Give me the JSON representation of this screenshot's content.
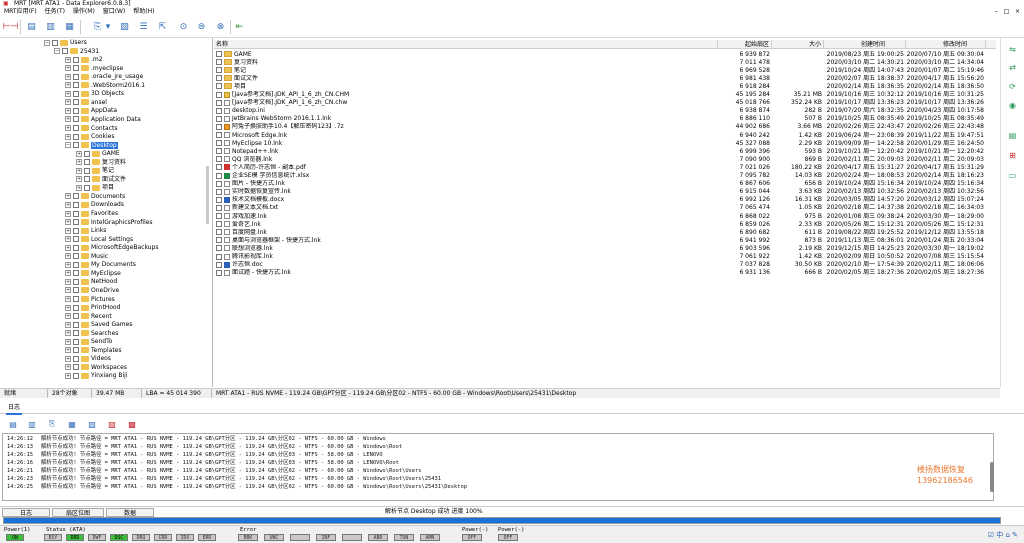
{
  "window": {
    "title": "MRT [MRT ATA1 - Data Explorer6.0.8.3]",
    "controls": [
      "–",
      "□",
      "×"
    ]
  },
  "menu": [
    "MRT应用(F)",
    "任务(T)",
    "操作(M)",
    "窗口(W)",
    "帮助(H)"
  ],
  "tree": [
    {
      "label": "Users",
      "depth": 0,
      "expander": "−"
    },
    {
      "label": "25431",
      "depth": 1,
      "expander": "−"
    },
    {
      "label": ".m2",
      "depth": 2,
      "expander": "+"
    },
    {
      "label": ".myeclipse",
      "depth": 2,
      "expander": "+"
    },
    {
      "label": ".oracle_jre_usage",
      "depth": 2,
      "expander": "+"
    },
    {
      "label": ".WebStorm2016.1",
      "depth": 2,
      "expander": "+"
    },
    {
      "label": "3D Objects",
      "depth": 2,
      "expander": "+"
    },
    {
      "label": "ansel",
      "depth": 2,
      "expander": "+"
    },
    {
      "label": "AppData",
      "depth": 2,
      "expander": "+"
    },
    {
      "label": "Application Data",
      "depth": 2,
      "expander": "+"
    },
    {
      "label": "Contacts",
      "depth": 2,
      "expander": "+"
    },
    {
      "label": "Cookies",
      "depth": 2,
      "expander": "+"
    },
    {
      "label": "Desktop",
      "depth": 2,
      "expander": "−",
      "selected": true
    },
    {
      "label": "GAME",
      "depth": 3,
      "expander": "+"
    },
    {
      "label": "复习资料",
      "depth": 3,
      "expander": "+"
    },
    {
      "label": "笔记",
      "depth": 3,
      "expander": "+"
    },
    {
      "label": "面试文件",
      "depth": 3,
      "expander": "+"
    },
    {
      "label": "项目",
      "depth": 3,
      "expander": "+"
    },
    {
      "label": "Documents",
      "depth": 2,
      "expander": "+"
    },
    {
      "label": "Downloads",
      "depth": 2,
      "expander": "+"
    },
    {
      "label": "Favorites",
      "depth": 2,
      "expander": "+"
    },
    {
      "label": "IntelGraphicsProfiles",
      "depth": 2,
      "expander": "+"
    },
    {
      "label": "Links",
      "depth": 2,
      "expander": "+"
    },
    {
      "label": "Local Settings",
      "depth": 2,
      "expander": "+"
    },
    {
      "label": "MicrosoftEdgeBackups",
      "depth": 2,
      "expander": "+"
    },
    {
      "label": "Music",
      "depth": 2,
      "expander": "+"
    },
    {
      "label": "My Documents",
      "depth": 2,
      "expander": "+"
    },
    {
      "label": "MyEclipse",
      "depth": 2,
      "expander": "+"
    },
    {
      "label": "NetHood",
      "depth": 2,
      "expander": "+"
    },
    {
      "label": "OneDrive",
      "depth": 2,
      "expander": "+"
    },
    {
      "label": "Pictures",
      "depth": 2,
      "expander": "+"
    },
    {
      "label": "PrintHood",
      "depth": 2,
      "expander": "+"
    },
    {
      "label": "Recent",
      "depth": 2,
      "expander": "+"
    },
    {
      "label": "Saved Games",
      "depth": 2,
      "expander": "+"
    },
    {
      "label": "Searches",
      "depth": 2,
      "expander": "+"
    },
    {
      "label": "SendTo",
      "depth": 2,
      "expander": "+"
    },
    {
      "label": "Templates",
      "depth": 2,
      "expander": "+"
    },
    {
      "label": "Videos",
      "depth": 2,
      "expander": "+"
    },
    {
      "label": "Workspaces",
      "depth": 2,
      "expander": "+"
    },
    {
      "label": "Yinxiang Biji",
      "depth": 2,
      "expander": "+"
    }
  ],
  "columns": {
    "name": "名称",
    "start_sector": "起始扇区",
    "size": "大小",
    "created": "创建时间",
    "modified": "修改时间"
  },
  "files": [
    {
      "name": "GAME",
      "icon": "folder",
      "start": "6 939 872",
      "size": "",
      "created": "2019/08/23 周五 19:00:25",
      "modified": "2020/07/10 周五 09:30:04"
    },
    {
      "name": "复习资料",
      "icon": "folder",
      "start": "7 011 478",
      "size": "",
      "created": "2020/03/10 周二 14:30:21",
      "modified": "2020/03/10 周二 14:34:04"
    },
    {
      "name": "笔记",
      "icon": "folder",
      "start": "6 969 528",
      "size": "",
      "created": "2019/10/24 周四 14:07:43",
      "modified": "2020/01/07 周二 15:19:46"
    },
    {
      "name": "面试文件",
      "icon": "folder",
      "start": "6 981 438",
      "size": "",
      "created": "2020/02/07 周五 18:38:37",
      "modified": "2020/04/17 周五 15:56:20"
    },
    {
      "name": "项目",
      "icon": "folder",
      "start": "6 918 284",
      "size": "",
      "created": "2020/02/14 周五 18:36:35",
      "modified": "2020/02/14 周五 18:36:50"
    },
    {
      "name": "[Java参考文档].JDK_API_1_6_zh_CN.CHM",
      "icon": "chm",
      "start": "45 195 284",
      "size": "35.21 MB",
      "created": "2019/10/16 周三 10:32:12",
      "modified": "2019/10/16 周三 10:31:25"
    },
    {
      "name": "[Java参考文档].JDK_API_1_6_zh_CN.chw",
      "icon": "file",
      "start": "45 018 766",
      "size": "352.24 KB",
      "created": "2019/10/17 周四 13:36:23",
      "modified": "2019/10/17 周四 13:36:26"
    },
    {
      "name": "desktop.ini",
      "icon": "file",
      "start": "6 938 874",
      "size": "282 B",
      "created": "2019/07/20 周六 18:32:35",
      "modified": "2020/04/23 周四 10:17:58"
    },
    {
      "name": "JetBrains WebStorm 2016.1.1.lnk",
      "icon": "file",
      "start": "6 886 110",
      "size": "507 B",
      "created": "2019/10/25 周五 08:35:49",
      "modified": "2019/10/25 周五 08:35:49"
    },
    {
      "name": "阿兔子换肤助手10.4【解压密码123】.7z",
      "icon": "exe",
      "start": "44 902 686",
      "size": "3.66 MB",
      "created": "2020/02/26 周三 22:43:47",
      "modified": "2020/02/26 周三 22:43:48"
    },
    {
      "name": "Microsoft Edge.lnk",
      "icon": "file",
      "start": "6 940 242",
      "size": "1.42 KB",
      "created": "2019/06/24 周一 23:08:39",
      "modified": "2019/11/22 周五 19:47:51"
    },
    {
      "name": "MyEclipse 10.lnk",
      "icon": "file",
      "start": "45 327 088",
      "size": "2.29 KB",
      "created": "2019/09/09 周一 14:22:58",
      "modified": "2020/01/29 周三 16:24:50"
    },
    {
      "name": "Notepad++.lnk",
      "icon": "file",
      "start": "6 999 396",
      "size": "593 B",
      "created": "2019/10/21 周一 12:20:42",
      "modified": "2019/10/21 周一 12:20:42"
    },
    {
      "name": "QQ 浏览器.lnk",
      "icon": "file",
      "start": "7 090 900",
      "size": "869 B",
      "created": "2020/02/11 周二 20:09:03",
      "modified": "2020/02/11 周二 20:09:03"
    },
    {
      "name": "个人简历-许志恒 - 副本.pdf",
      "icon": "pdf",
      "start": "7 021 026",
      "size": "180.22 KB",
      "created": "2020/04/17 周五 15:31:27",
      "modified": "2020/04/17 周五 15:31:29"
    },
    {
      "name": "企业SE模 学员信息统计.xlsx",
      "icon": "xls",
      "start": "7 095 782",
      "size": "14.03 KB",
      "created": "2020/02/24 周一 18:08:53",
      "modified": "2020/02/14 周五 18:16:23"
    },
    {
      "name": "图片 - 快捷方式.lnk",
      "icon": "file",
      "start": "6 867 606",
      "size": "656 B",
      "created": "2019/10/24 周四 15:16:34",
      "modified": "2019/10/24 周四 15:16:34"
    },
    {
      "name": "实时数据恢复宣传.lnk",
      "icon": "file",
      "start": "6 915 044",
      "size": "3.63 KB",
      "created": "2020/02/13 周四 10:32:56",
      "modified": "2020/02/13 周四 10:32:56"
    },
    {
      "name": "技术文档模板.docx",
      "icon": "doc",
      "start": "6 992 126",
      "size": "16.31 KB",
      "created": "2020/03/05 周四 14:57:20",
      "modified": "2020/03/12 周四 15:07:24"
    },
    {
      "name": "新建文本文档.txt",
      "icon": "file",
      "start": "7 065 474",
      "size": "1.05 KB",
      "created": "2020/02/18 周二 14:37:38",
      "modified": "2020/02/18 周二 16:34:03"
    },
    {
      "name": "游戏加速.lnk",
      "icon": "file",
      "start": "6 868 022",
      "size": "975 B",
      "created": "2020/01/08 周三 09:38:24",
      "modified": "2020/03/30 周一 18:29:00"
    },
    {
      "name": "爱奇艺.lnk",
      "icon": "file",
      "start": "6 859 026",
      "size": "2.33 KB",
      "created": "2020/05/26 周二 15:12:31",
      "modified": "2020/05/26 周二 15:12:31"
    },
    {
      "name": "百度网盘.lnk",
      "icon": "file",
      "start": "6 890 682",
      "size": "611 B",
      "created": "2019/08/22 周四 19:25:52",
      "modified": "2019/12/12 周四 13:55:18"
    },
    {
      "name": "桌面与浏览器框架 - 快捷方式.lnk",
      "icon": "file",
      "start": "6 941 992",
      "size": "873 B",
      "created": "2019/11/13 周三 08:36:01",
      "modified": "2020/01/24 周五 20:33:04"
    },
    {
      "name": "联想浏览器.lnk",
      "icon": "file",
      "start": "6 903 596",
      "size": "2.19 KB",
      "created": "2019/12/15 周日 14:25:23",
      "modified": "2020/03/30 周一 18:19:02"
    },
    {
      "name": "腾讯影视库.lnk",
      "icon": "file",
      "start": "7 061 922",
      "size": "1.42 KB",
      "created": "2020/02/09 周日 10:50:52",
      "modified": "2020/07/08 周三 15:15:54"
    },
    {
      "name": "许志恒.doc",
      "icon": "doc",
      "start": "7 037 828",
      "size": "30.50 KB",
      "created": "2020/02/10 周一 17:54:39",
      "modified": "2020/02/11 周二 18:06:06"
    },
    {
      "name": "面试题 - 快捷方式.lnk",
      "icon": "file",
      "start": "6 931 136",
      "size": "666 B",
      "created": "2020/02/05 周三 18:27:36",
      "modified": "2020/02/05 周三 18:27:36"
    }
  ],
  "status": {
    "ready": "就绪",
    "items": "28个对象",
    "size": "39.47 MB",
    "lba": "LBA = 45 014 390",
    "path": "MRT ATA1 - RUS NVME - 119.24 GB\\GPT分区 - 119.24 GB\\分区02 - NTFS - 60.00 GB - Windows\\Root\\Users\\25431\\Desktop"
  },
  "log": {
    "tab": "日志",
    "rows": [
      {
        "time": "14:26:12",
        "msg": "解析节点成功! 节点路径 = MRT ATA1 - RUS NVME - 119.24 GB\\GPT分区 - 119.24 GB\\分区02 - NTFS - 60.00 GB - Windows"
      },
      {
        "time": "14:26:13",
        "msg": "解析节点成功! 节点路径 = MRT ATA1 - RUS NVME - 119.24 GB\\GPT分区 - 119.24 GB\\分区02 - NTFS - 60.00 GB - Windows\\Root"
      },
      {
        "time": "14:26:15",
        "msg": "解析节点成功! 节点路径 = MRT ATA1 - RUS NVME - 119.24 GB\\GPT分区 - 119.24 GB\\分区03 - NTFS - 58.00 GB - LENOVO"
      },
      {
        "time": "14:26:16",
        "msg": "解析节点成功! 节点路径 = MRT ATA1 - RUS NVME - 119.24 GB\\GPT分区 - 119.24 GB\\分区03 - NTFS - 58.00 GB - LENOVO\\Root"
      },
      {
        "time": "14:26:21",
        "msg": "解析节点成功! 节点路径 = MRT ATA1 - RUS NVME - 119.24 GB\\GPT分区 - 119.24 GB\\分区02 - NTFS - 60.00 GB - Windows\\Root\\Users"
      },
      {
        "time": "14:26:23",
        "msg": "解析节点成功! 节点路径 = MRT ATA1 - RUS NVME - 119.24 GB\\GPT分区 - 119.24 GB\\分区02 - NTFS - 60.00 GB - Windows\\Root\\Users\\25431"
      },
      {
        "time": "14:26:25",
        "msg": "解析节点成功! 节点路径 = MRT ATA1 - RUS NVME - 119.24 GB\\GPT分区 - 119.24 GB\\分区02 - NTFS - 60.00 GB - Windows\\Root\\Users\\25431\\Desktop"
      }
    ],
    "watermark_1": "楼扬数据恢复",
    "watermark_2": "13962186546"
  },
  "bottom_tabs": [
    "日志",
    "扇区位图",
    "数据"
  ],
  "progress": {
    "text": "解析节点 Desktop 成功  进度 100%",
    "value": 1.0
  },
  "device": {
    "power1": {
      "label": "Power(1)",
      "led": "ON"
    },
    "status_label": "Status (ATA)",
    "status_leds": [
      {
        "t": "BSY",
        "on": false
      },
      {
        "t": "DRD",
        "on": true
      },
      {
        "t": "DWF",
        "on": false
      },
      {
        "t": "DSC",
        "on": true
      },
      {
        "t": "DRQ",
        "on": false
      },
      {
        "t": "CRR",
        "on": false
      },
      {
        "t": "IDX",
        "on": false
      },
      {
        "t": "ERR",
        "on": false
      }
    ],
    "error_label": "Error",
    "error_leds": [
      "BBK",
      "UNC",
      "",
      "INF",
      "",
      "ABR",
      "TON",
      "AMN"
    ],
    "power2": {
      "label": "Power(-)",
      "led": "OFF"
    },
    "power3": {
      "label": "Power(-)",
      "led": "OFF"
    },
    "tray": "☑ 中 ⌂ ✎"
  }
}
